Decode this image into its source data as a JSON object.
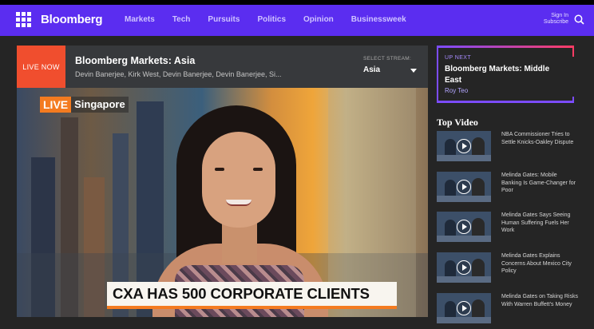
{
  "nav": {
    "logo": "Bloomberg",
    "links": [
      "Markets",
      "Tech",
      "Pursuits",
      "Politics",
      "Opinion",
      "Businessweek"
    ],
    "sign_in": "Sign In",
    "subscribe": "Subscribe",
    "accent_color": "#5b2df0"
  },
  "stream": {
    "live_label": "LIVE NOW",
    "title": "Bloomberg Markets: Asia",
    "hosts": "Devin Banerjee, Kirk West, Devin Banerjee, Devin Banerjee, Si...",
    "select_label": "SELECT STREAM:",
    "selected": "Asia"
  },
  "video": {
    "live_word": "LIVE",
    "location": "Singapore",
    "headline": "CXA HAS 500 CORPORATE CLIENTS"
  },
  "up_next": {
    "label": "UP NEXT",
    "title": "Bloomberg Markets: Middle East",
    "author": "Roy Teo"
  },
  "top_video": {
    "heading": "Top Video",
    "items": [
      {
        "title": "NBA Commissioner Tries to Settle Knicks-Oakley Dispute",
        "icon": "play-icon"
      },
      {
        "title": "Melinda Gates: Mobile Banking Is Game-Changer for Poor",
        "icon": "play-icon"
      },
      {
        "title": "Melinda Gates Says Seeing Human Suffering Fuels Her Work",
        "icon": "play-icon"
      },
      {
        "title": "Melinda Gates Explains Concerns About Mexico City Policy",
        "icon": "play-icon"
      },
      {
        "title": "Melinda Gates on Taking Risks With Warren Buffett's Money",
        "icon": "play-icon"
      }
    ]
  }
}
